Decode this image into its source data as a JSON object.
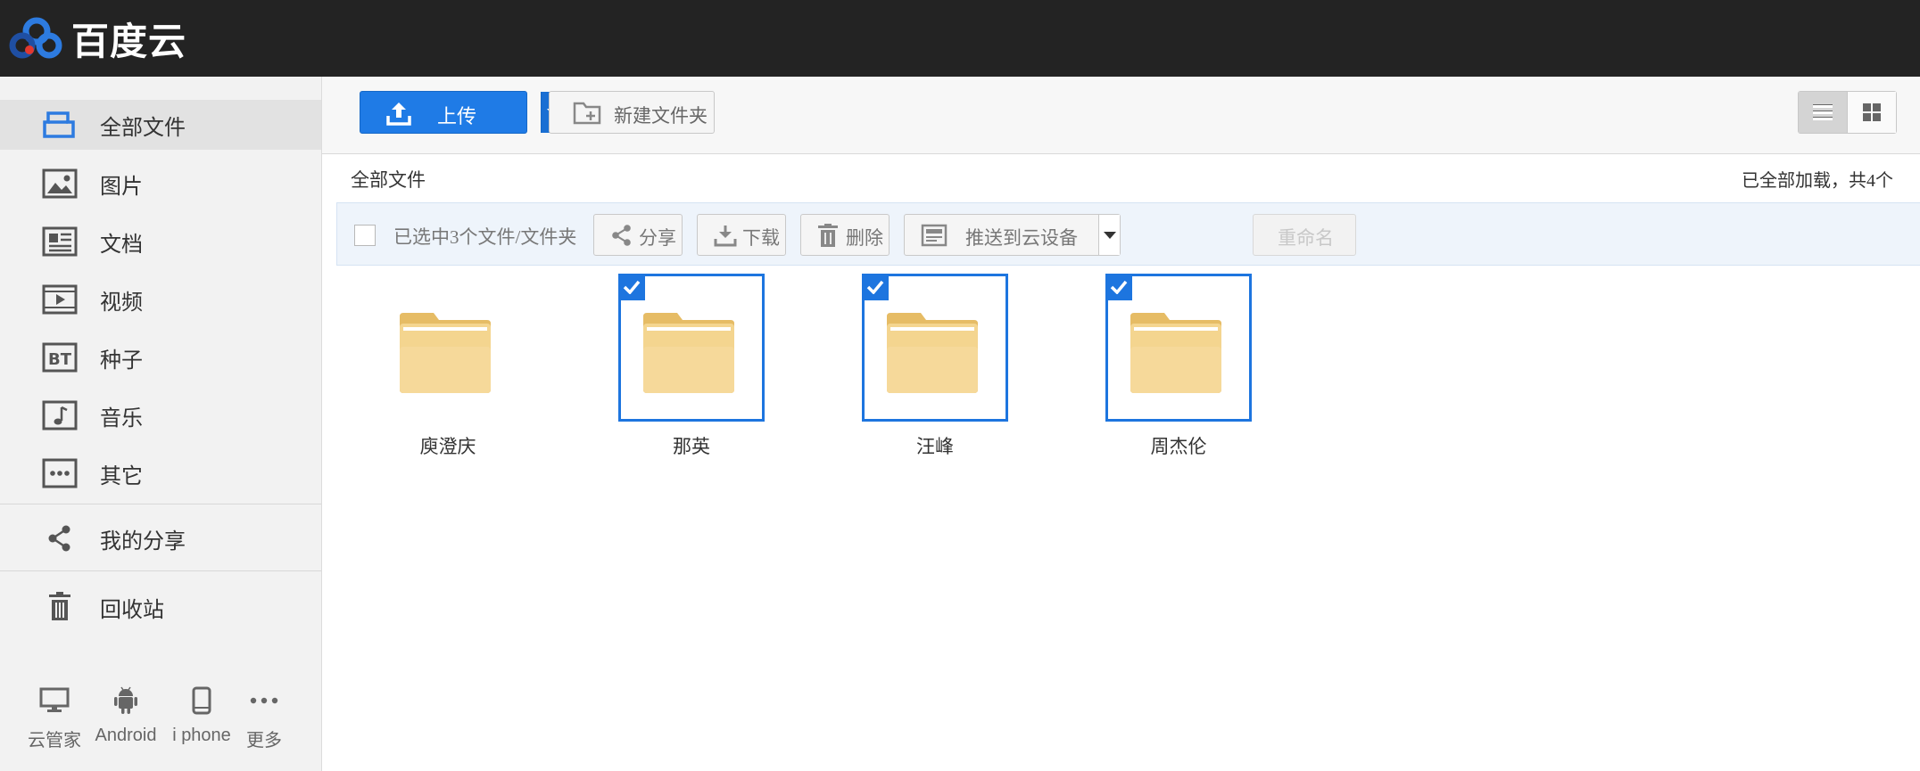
{
  "app": {
    "logo_text": "百度云",
    "brand_colors": {
      "blue": "#2d7be0",
      "red": "#e2382f",
      "dark_blue": "#1f4fa3"
    }
  },
  "sidebar": {
    "items": [
      {
        "label": "全部文件",
        "icon": "all-files-icon",
        "active": true
      },
      {
        "label": "图片",
        "icon": "image-icon"
      },
      {
        "label": "文档",
        "icon": "document-icon"
      },
      {
        "label": "视频",
        "icon": "video-icon"
      },
      {
        "label": "种子",
        "icon": "bt-torrent-icon"
      },
      {
        "label": "音乐",
        "icon": "music-icon"
      },
      {
        "label": "其它",
        "icon": "more-dots-icon"
      }
    ],
    "share": {
      "label": "我的分享",
      "icon": "share-icon"
    },
    "recycle": {
      "label": "回收站",
      "icon": "trash-icon"
    },
    "clients": [
      {
        "label": "云管家",
        "icon": "desktop-icon"
      },
      {
        "label": "Android",
        "icon": "android-icon"
      },
      {
        "label": "i phone",
        "icon": "phone-icon"
      },
      {
        "label": "更多",
        "icon": "more-icon"
      }
    ]
  },
  "toolbar": {
    "upload_label": "上传",
    "new_folder_label": "新建文件夹",
    "view_mode": "list",
    "accent": "#1f7be6"
  },
  "breadcrumb": {
    "current": "全部文件"
  },
  "status": {
    "loaded_text": "已全部加载，共4个"
  },
  "actionbar": {
    "selection_text": "已选中3个文件/文件夹",
    "share_label": "分享",
    "download_label": "下载",
    "delete_label": "删除",
    "push_label": "推送到云设备",
    "rename_label": "重命名",
    "rename_disabled": true
  },
  "files": [
    {
      "name": "庾澄庆",
      "type": "folder",
      "selected": false
    },
    {
      "name": "那英",
      "type": "folder",
      "selected": true
    },
    {
      "name": "汪峰",
      "type": "folder",
      "selected": true
    },
    {
      "name": "周杰伦",
      "type": "folder",
      "selected": true
    }
  ]
}
